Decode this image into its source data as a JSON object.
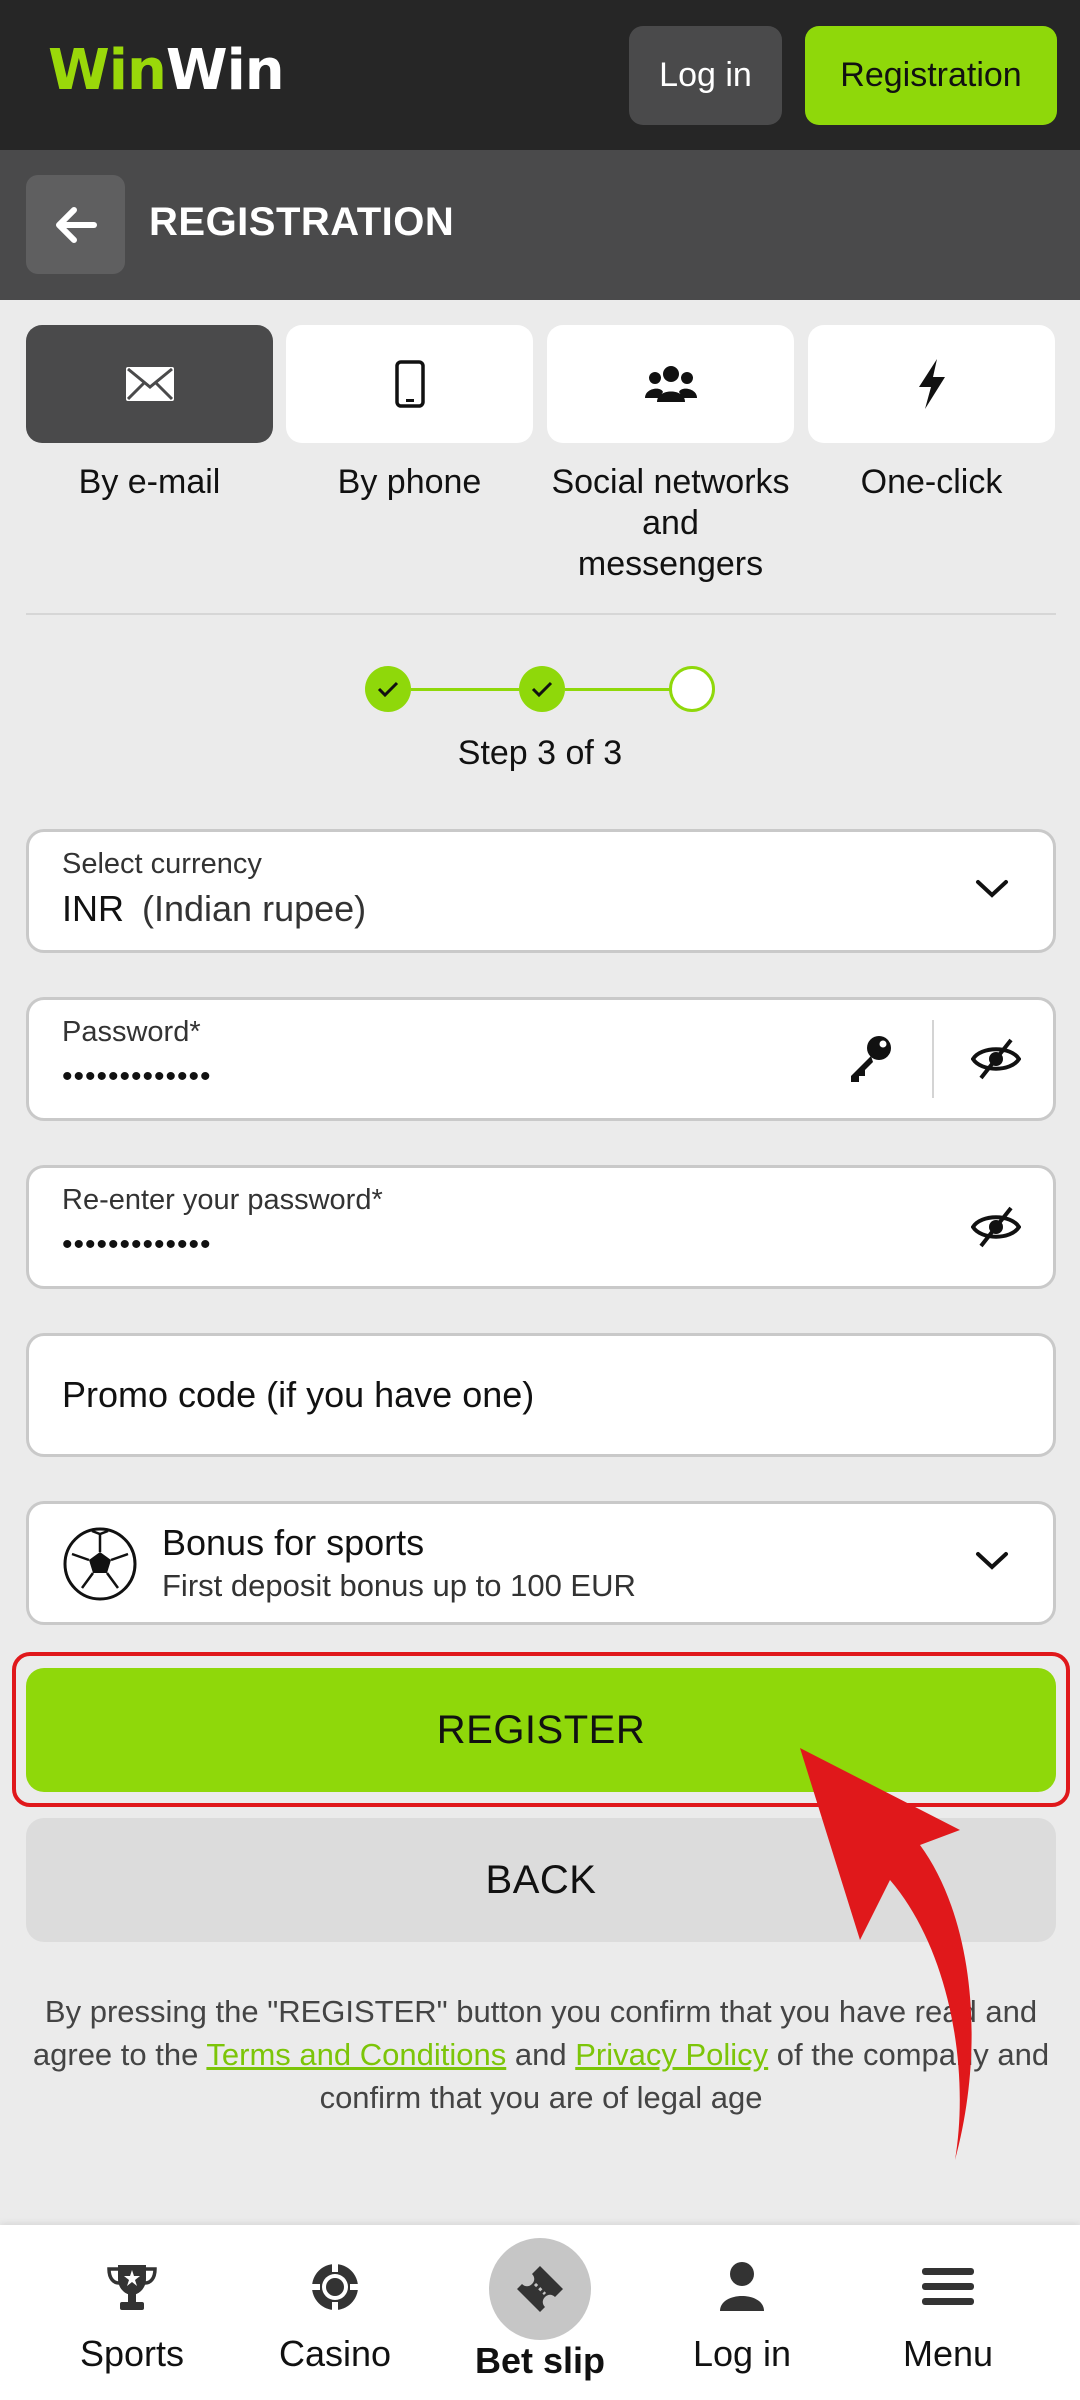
{
  "header": {
    "logo_part1": "Win",
    "logo_part2": "Win",
    "login_label": "Log in",
    "registration_label": "Registration"
  },
  "subheader": {
    "title": "REGISTRATION"
  },
  "methods": [
    {
      "label": "By e-mail",
      "icon": "envelope-icon",
      "active": true
    },
    {
      "label": "By phone",
      "icon": "phone-icon",
      "active": false
    },
    {
      "label": "Social networks and messengers",
      "icon": "users-icon",
      "active": false
    },
    {
      "label": "One-click",
      "icon": "lightning-icon",
      "active": false
    }
  ],
  "stepper": {
    "current": 3,
    "total": 3,
    "text": "Step 3 of 3"
  },
  "form": {
    "currency_label": "Select currency",
    "currency_code": "INR",
    "currency_name": "(Indian rupee)",
    "password_label": "Password*",
    "password_value": "•••••••••••••",
    "repassword_label": "Re-enter your password*",
    "repassword_value": "•••••••••••••",
    "promo_placeholder": "Promo code (if you have one)",
    "bonus_title": "Bonus for sports",
    "bonus_subtitle": "First deposit bonus up to 100 EUR"
  },
  "actions": {
    "register_label": "REGISTER",
    "back_label": "BACK"
  },
  "terms": {
    "part1": "By pressing the \"REGISTER\" button you confirm that you have read and agree to the",
    "terms_link": "Terms and Conditions",
    "and": "and",
    "privacy_link": "Privacy Policy",
    "part2": "of the company and confirm that you are of legal age"
  },
  "bottom_nav": {
    "sports": "Sports",
    "casino": "Casino",
    "betslip": "Bet slip",
    "login": "Log in",
    "menu": "Menu"
  },
  "colors": {
    "accent": "#8fd80a",
    "dark": "#262626",
    "annotation": "#e0181b"
  }
}
